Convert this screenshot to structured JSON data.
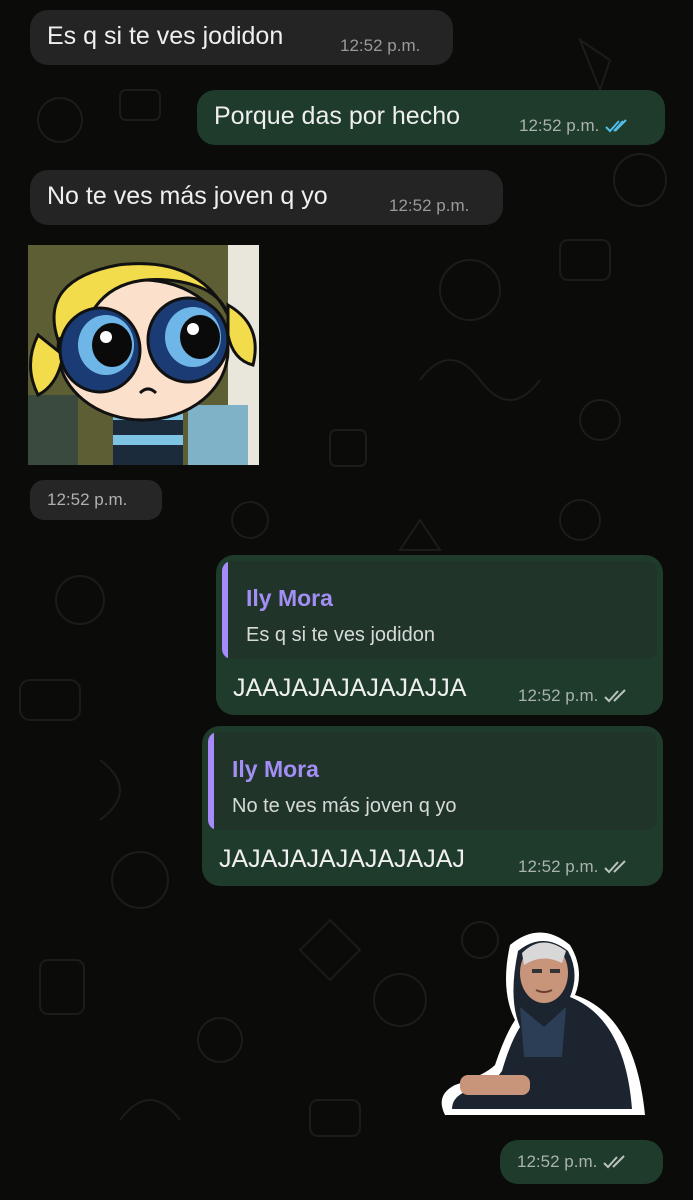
{
  "messages": [
    {
      "id": "m1",
      "direction": "incoming",
      "text": "Es q si te ves jodidon",
      "time": "12:52 p.m."
    },
    {
      "id": "m2",
      "direction": "outgoing",
      "text": "Porque das por hecho",
      "time": "12:52 p.m.",
      "status": "read"
    },
    {
      "id": "m3",
      "direction": "incoming",
      "text": "No te ves más joven q yo",
      "time": "12:52 p.m."
    },
    {
      "id": "m4",
      "direction": "incoming",
      "type": "image",
      "description_icon": "cartoon-sticker-image",
      "time": "12:52 p.m."
    },
    {
      "id": "m5",
      "direction": "outgoing",
      "reply_to": {
        "name": "Ily Mora",
        "text": "Es q si te ves jodidon"
      },
      "text": "JAAJAJAJAJAJAJJA",
      "time": "12:52 p.m.",
      "status": "delivered"
    },
    {
      "id": "m6",
      "direction": "outgoing",
      "reply_to": {
        "name": "Ily Mora",
        "text": "No te ves más joven q yo"
      },
      "text": "JAJAJAJAJAJAJAJAJ",
      "time": "12:52 p.m.",
      "status": "delivered"
    },
    {
      "id": "m7",
      "direction": "outgoing",
      "type": "sticker",
      "description_icon": "man-photo-sticker",
      "time": "12:52 p.m.",
      "status": "delivered"
    }
  ],
  "colors": {
    "background": "#0b0b0a",
    "incoming_bubble": "#242424",
    "outgoing_bubble": "#1e3b2b",
    "quote_accent": "#a78bfa",
    "read_ticks": "#53bdeb",
    "delivered_ticks": "#b9c2bc"
  }
}
